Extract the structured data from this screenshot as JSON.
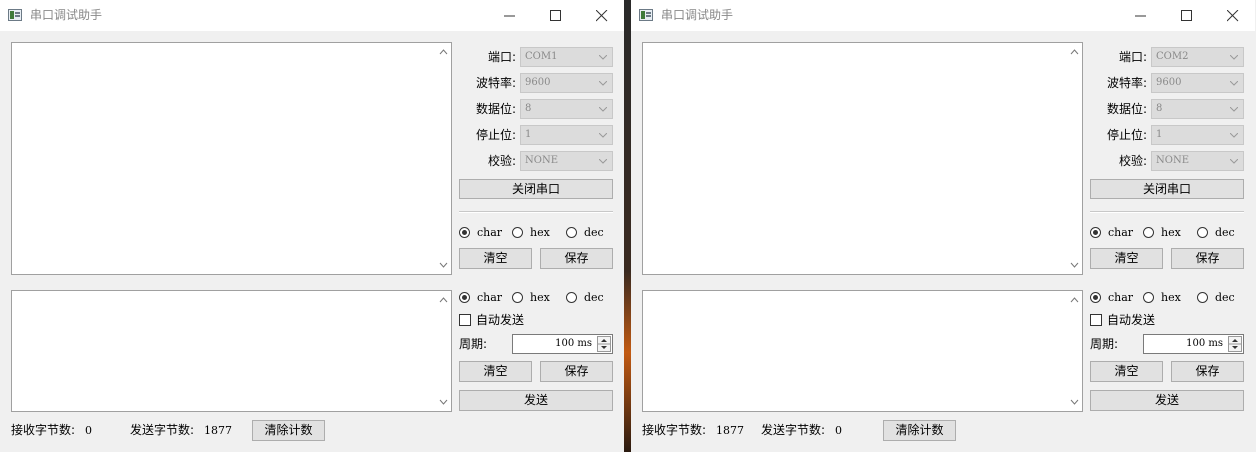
{
  "windows": [
    {
      "title": "串口调试助手",
      "settings": [
        {
          "label": "端口:",
          "value": "COM1"
        },
        {
          "label": "波特率:",
          "value": "9600"
        },
        {
          "label": "数据位:",
          "value": "8"
        },
        {
          "label": "停止位:",
          "value": "1"
        },
        {
          "label": "校验:",
          "value": "NONE"
        }
      ],
      "close_port_label": "关闭串口",
      "receive_format": {
        "options": [
          "char",
          "hex",
          "dec"
        ],
        "selected": "char"
      },
      "receive_clear_label": "清空",
      "receive_save_label": "保存",
      "send_format": {
        "options": [
          "char",
          "hex",
          "dec"
        ],
        "selected": "char"
      },
      "auto_send_label": "自动发送",
      "auto_send_checked": false,
      "period_label": "周期:",
      "period_value": "100 ms",
      "send_clear_label": "清空",
      "send_save_label": "保存",
      "send_label": "发送",
      "status": [
        {
          "label": "接收字节数:",
          "value": "0"
        },
        {
          "label": "发送字节数:",
          "value": "1877"
        }
      ],
      "clear_count_label": "清除计数"
    },
    {
      "title": "串口调试助手",
      "settings": [
        {
          "label": "端口:",
          "value": "COM2"
        },
        {
          "label": "波特率:",
          "value": "9600"
        },
        {
          "label": "数据位:",
          "value": "8"
        },
        {
          "label": "停止位:",
          "value": "1"
        },
        {
          "label": "校验:",
          "value": "NONE"
        }
      ],
      "close_port_label": "关闭串口",
      "receive_format": {
        "options": [
          "char",
          "hex",
          "dec"
        ],
        "selected": "char"
      },
      "receive_clear_label": "清空",
      "receive_save_label": "保存",
      "send_format": {
        "options": [
          "char",
          "hex",
          "dec"
        ],
        "selected": "char"
      },
      "auto_send_label": "自动发送",
      "auto_send_checked": false,
      "period_label": "周期:",
      "period_value": "100 ms",
      "send_clear_label": "清空",
      "send_save_label": "保存",
      "send_label": "发送",
      "status": [
        {
          "label": "接收字节数:",
          "value": "1877"
        },
        {
          "label": "发送字节数:",
          "value": "0"
        }
      ],
      "clear_count_label": "清除计数"
    }
  ]
}
